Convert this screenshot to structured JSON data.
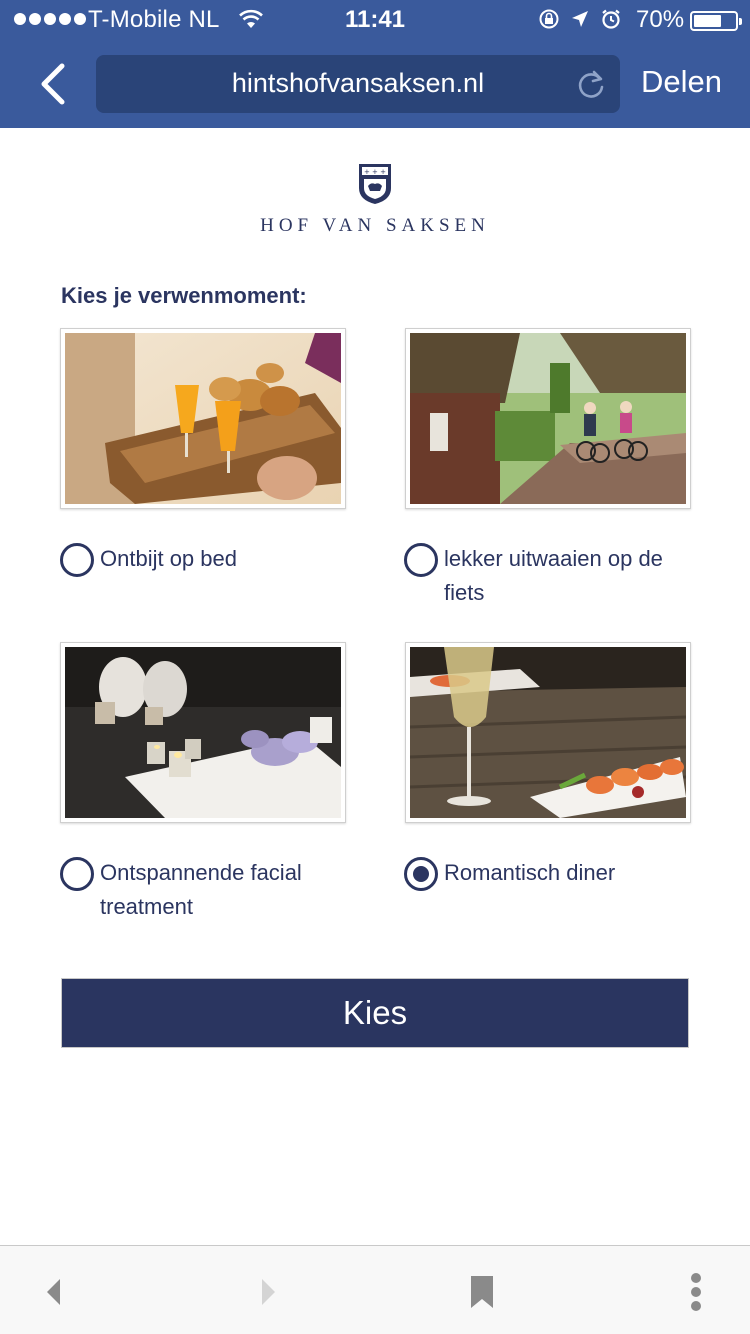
{
  "status_bar": {
    "carrier": "T-Mobile NL",
    "time": "11:41",
    "battery": "70%",
    "battery_level": 0.7,
    "signal_bars": 5
  },
  "browser": {
    "url": "hintshofvansaksen.nl",
    "share_label": "Delen",
    "icons": [
      "back-chevron-icon",
      "reload-icon"
    ]
  },
  "page": {
    "brand": "HOF VAN SAKSEN",
    "heading": "Kies je verwenmoment:",
    "options": [
      {
        "label": "Ontbijt op bed",
        "image": "breakfast-tray-photo",
        "checked": false
      },
      {
        "label": "lekker uitwaaien op de fiets",
        "image": "cycling-couple-photo",
        "checked": false
      },
      {
        "label": "Ontspannende facial treatment",
        "image": "spa-candles-photo",
        "checked": false
      },
      {
        "label": "Romantisch diner",
        "image": "champagne-dinner-photo",
        "checked": true
      }
    ],
    "submit_label": "Kies"
  },
  "toolbar": {
    "icons": [
      "back-arrow-icon",
      "forward-arrow-icon",
      "bookmark-icon",
      "more-icon"
    ]
  },
  "colors": {
    "header_blue": "#3a5a9c",
    "url_field": "#2a4478",
    "brand_navy": "#2b3560",
    "button_navy": "#2a3560"
  }
}
